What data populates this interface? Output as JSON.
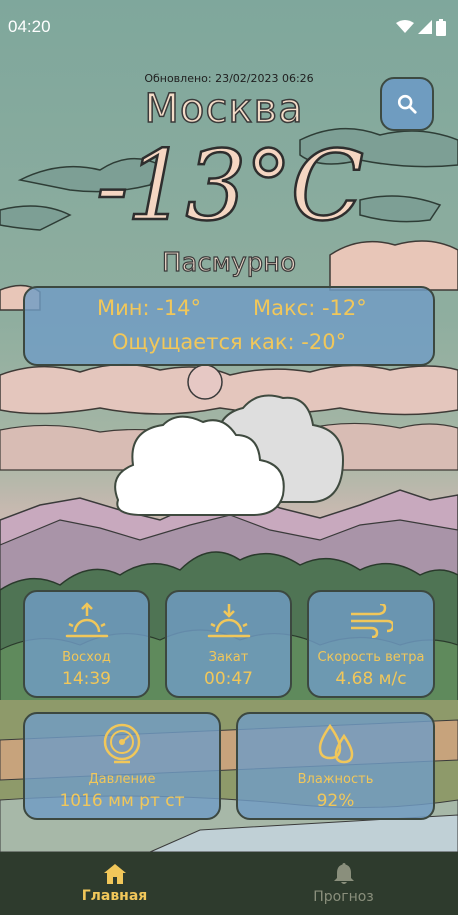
{
  "status_bar": {
    "time": "04:20"
  },
  "header": {
    "updated": "Обновлено: 23/02/2023 06:26",
    "city": "Москва",
    "temperature": "-13°C",
    "condition": "Пасмурно"
  },
  "summary": {
    "min": "Мин: -14°",
    "max": "Макс: -12°",
    "feels_like": "Ощущается как: -20°"
  },
  "details": {
    "sunrise": {
      "label": "Восход",
      "value": "14:39",
      "icon": "sunrise-icon"
    },
    "sunset": {
      "label": "Закат",
      "value": "00:47",
      "icon": "sunset-icon"
    },
    "wind": {
      "label": "Скорость ветра",
      "value": "4.68 м/с",
      "icon": "wind-icon"
    },
    "pressure": {
      "label": "Давление",
      "value": "1016 мм рт ст",
      "icon": "pressure-icon"
    },
    "humidity": {
      "label": "Влажность",
      "value": "92%",
      "icon": "humidity-icon"
    }
  },
  "nav": {
    "home": {
      "label": "Главная",
      "icon": "home-icon",
      "active": true
    },
    "forecast": {
      "label": "Прогноз",
      "icon": "bell-icon",
      "active": false
    }
  },
  "colors": {
    "accent": "#f1c75a",
    "card": "#709cc4",
    "nav_bg": "#2e3b2d"
  }
}
